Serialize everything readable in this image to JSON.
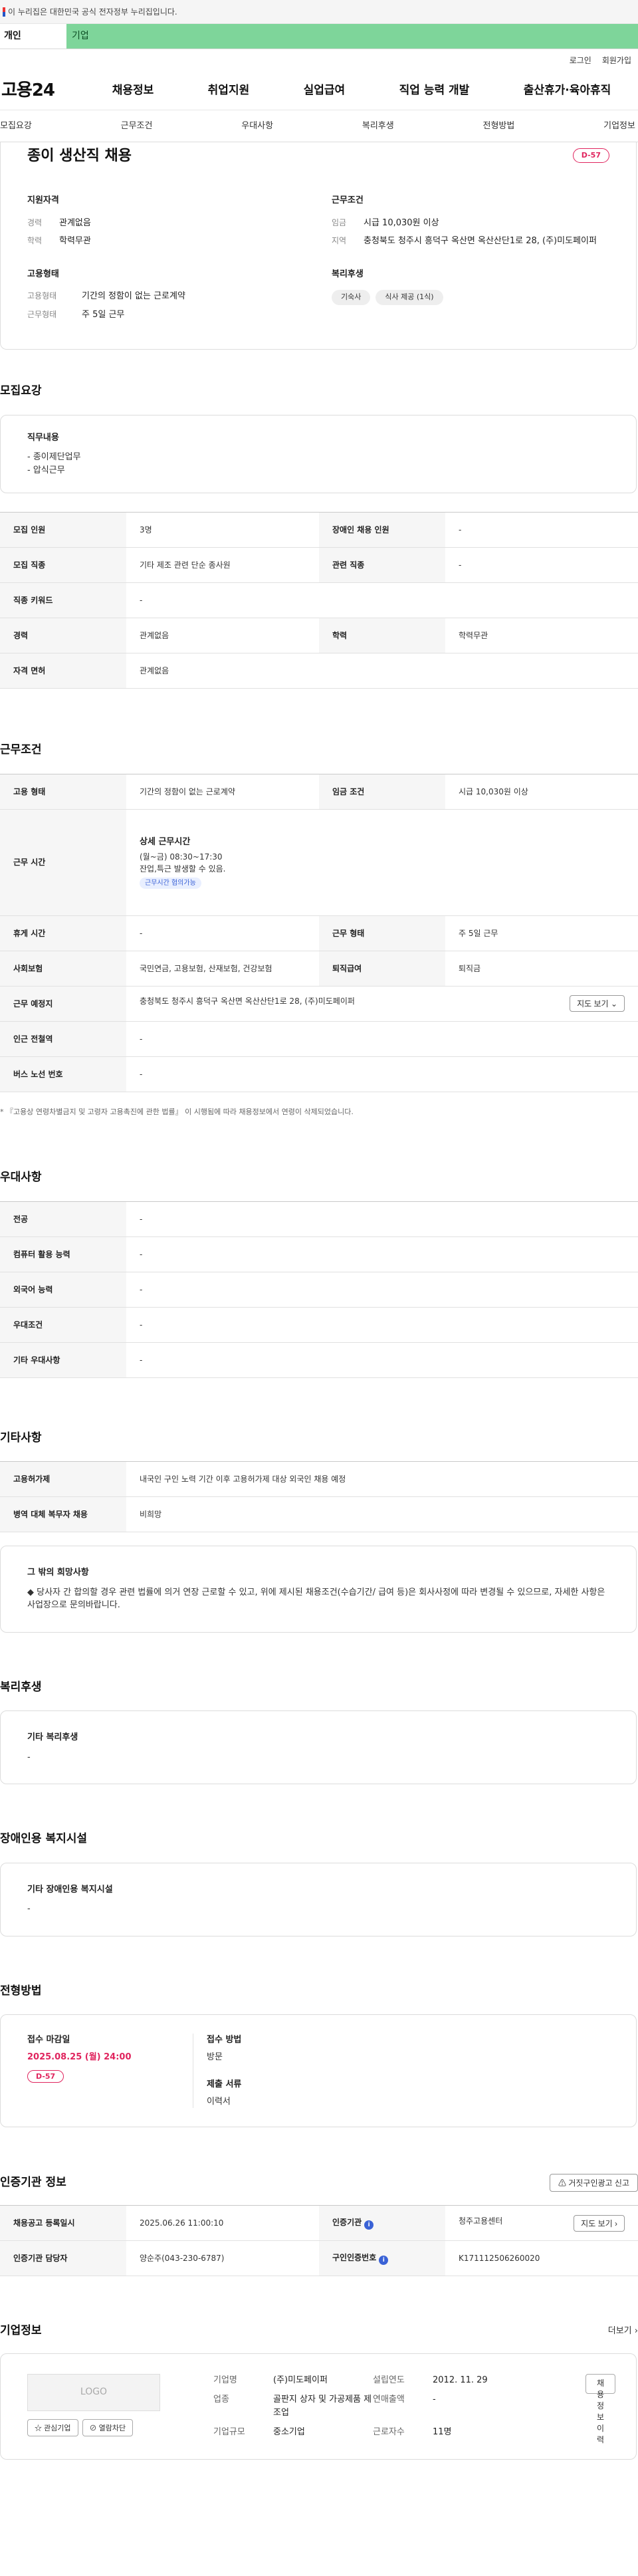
{
  "gov_banner": "이 누리집은 대한민국 공식 전자정부 누리집입니다.",
  "user_tabs": {
    "active": "개인",
    "inactive": "기업"
  },
  "util": {
    "login": "로그인",
    "signup": "회원가입"
  },
  "logo": "고용24",
  "gnb": [
    "채용정보",
    "취업지원",
    "실업급여",
    "직업 능력 개발",
    "출산휴가·육아휴직"
  ],
  "anchor_nav": [
    "모집요강",
    "근무조건",
    "우대사항",
    "복리후생",
    "전형방법",
    "기업정보"
  ],
  "summary": {
    "title": "종이 생산직 채용",
    "dday": "D-57",
    "qualification": {
      "heading": "지원자격",
      "career_k": "경력",
      "career_v": "관계없음",
      "edu_k": "학력",
      "edu_v": "학력무관"
    },
    "conditions": {
      "heading": "근무조건",
      "wage_k": "임금",
      "wage_v": "시급 10,030원 이상",
      "area_k": "지역",
      "area_v": "충청북도 청주시 흥덕구 옥산면 옥산산단1로 28, (주)미도페이퍼"
    },
    "employment": {
      "heading": "고용형태",
      "type_k": "고용형태",
      "type_v": "기간의 정함이 없는 근로계약",
      "days_k": "근무형태",
      "days_v": "주 5일 근무"
    },
    "welfare": {
      "heading": "복리후생",
      "chips": [
        "기숙사",
        "식사 제공 (1식)"
      ]
    }
  },
  "recruit": {
    "title": "모집요강",
    "duty_heading": "직무내용",
    "duty_lines": [
      "- 종이제단업무",
      "- 압식근무"
    ],
    "rows": [
      [
        "모집 인원",
        "3명",
        "장애인 채용 인원",
        "-"
      ],
      [
        "모집 직종",
        "기타 제조 관련 단순 종사원",
        "관련 직종",
        "-"
      ],
      [
        "직종 키워드",
        "-"
      ],
      [
        "경력",
        "관계없음",
        "학력",
        "학력무관"
      ],
      [
        "자격 면허",
        "관계없음"
      ]
    ]
  },
  "work": {
    "title": "근무조건",
    "row1": [
      "고용 형태",
      "기간의 정함이 없는 근로계약",
      "임금 조건",
      "시급 10,030원 이상"
    ],
    "time_label": "근무 시간",
    "time_heading": "상세 근무시간",
    "time_line1": "(월~금) 08:30~17:30",
    "time_line2": "잔업,특근 발생할 수 있음.",
    "time_tag": "근무시간 협의가능",
    "row3": [
      "휴게 시간",
      "-",
      "근무 형태",
      "주 5일 근무"
    ],
    "row4": [
      "사회보험",
      "국민연금, 고용보험, 산재보험, 건강보험",
      "퇴직급여",
      "퇴직금"
    ],
    "place_label": "근무 예정지",
    "place_value": "충청북도 청주시 흥덕구 옥산면 옥산산단1로 28, (주)미도페이퍼",
    "map_button": "지도 보기",
    "row6": [
      "인근 전철역",
      "-"
    ],
    "row7": [
      "버스 노선 번호",
      "-"
    ],
    "note": "* 『고용상 연령차별금지 및 고령자 고용촉진에 관한 법률』 이 시행됨에 따라 채용정보에서 연령이 삭제되었습니다."
  },
  "prefer": {
    "title": "우대사항",
    "rows": [
      [
        "전공",
        "-"
      ],
      [
        "컴퓨터 활용 능력",
        "-"
      ],
      [
        "외국어 능력",
        "-"
      ],
      [
        "우대조건",
        "-"
      ],
      [
        "기타 우대사항",
        "-"
      ]
    ]
  },
  "etc": {
    "title": "기타사항",
    "rows": [
      [
        "고용허가제",
        "내국인 구인 노력 기간 이후 고용허가제 대상 외국인 채용 예정"
      ],
      [
        "병역 대체 복무자 채용",
        "비희망"
      ]
    ],
    "wish_heading": "그 밖의 희망사항",
    "wish_text": "◆ 당사자 간 합의할 경우 관련 법률에 의거 연장 근로할 수 있고, 위에 제시된 채용조건(수습기간/ 급여 등)은 회사사정에 따라 변경될 수 있으므로, 자세한 사항은 사업장으로 문의바랍니다."
  },
  "benefit": {
    "title": "복리후생",
    "heading": "기타 복리후생",
    "value": "-"
  },
  "disabled": {
    "title": "장애인용 복지시설",
    "heading": "기타 장애인용 복지시설",
    "value": "-"
  },
  "apply": {
    "title": "전형방법",
    "deadline_label": "접수 마감일",
    "deadline": "2025.08.25 (월) 24:00",
    "dday": "D-57",
    "method_label": "접수 방법",
    "method": "방문",
    "docs_label": "제출 서류",
    "docs": "이력서"
  },
  "cert": {
    "title": "인증기관 정보",
    "report_button": "거짓구인광고 신고",
    "row1": [
      "채용공고 등록일시",
      "2025.06.26 11:00:10",
      "인증기관",
      "청주고용센터"
    ],
    "map_button": "지도 보기",
    "row2": [
      "인증기관 담당자",
      "양순주(043-230-6787)",
      "구인인증번호",
      "K171112506260020"
    ]
  },
  "company": {
    "title": "기업정보",
    "more": "더보기",
    "logo_text": "LOGO",
    "fav_button": "관심기업",
    "block_button": "열람차단",
    "history_button": "채용정보 이력",
    "name_k": "기업명",
    "name_v": "(주)미도페이퍼",
    "est_k": "설립연도",
    "est_v": "2012. 11. 29",
    "industry_k": "업종",
    "industry_v": "골판지 상자 및 가공제품 제조업",
    "sales_k": "연매출액",
    "sales_v": "-",
    "size_k": "기업규모",
    "size_v": "중소기업",
    "staff_k": "근로자수",
    "staff_v": "11명"
  }
}
